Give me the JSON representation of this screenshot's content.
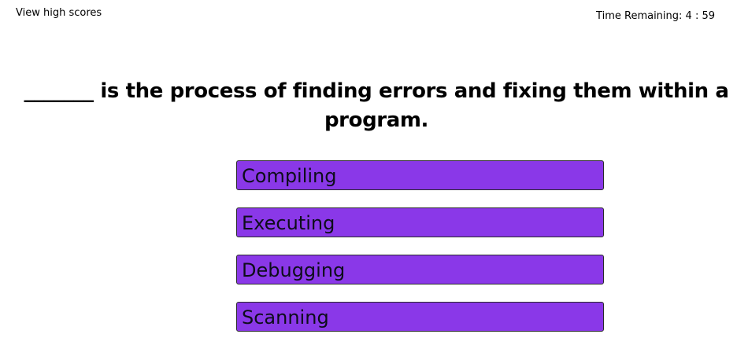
{
  "header": {
    "high_scores_link": "View high scores",
    "timer_label": "Time Remaining: 4 : 59"
  },
  "quiz": {
    "question": "_______ is the process of finding errors and fixing them within a program.",
    "answers": [
      {
        "label": "Compiling"
      },
      {
        "label": "Executing"
      },
      {
        "label": "Debugging"
      },
      {
        "label": "Scanning"
      }
    ],
    "button_color": "#8a38e8"
  }
}
